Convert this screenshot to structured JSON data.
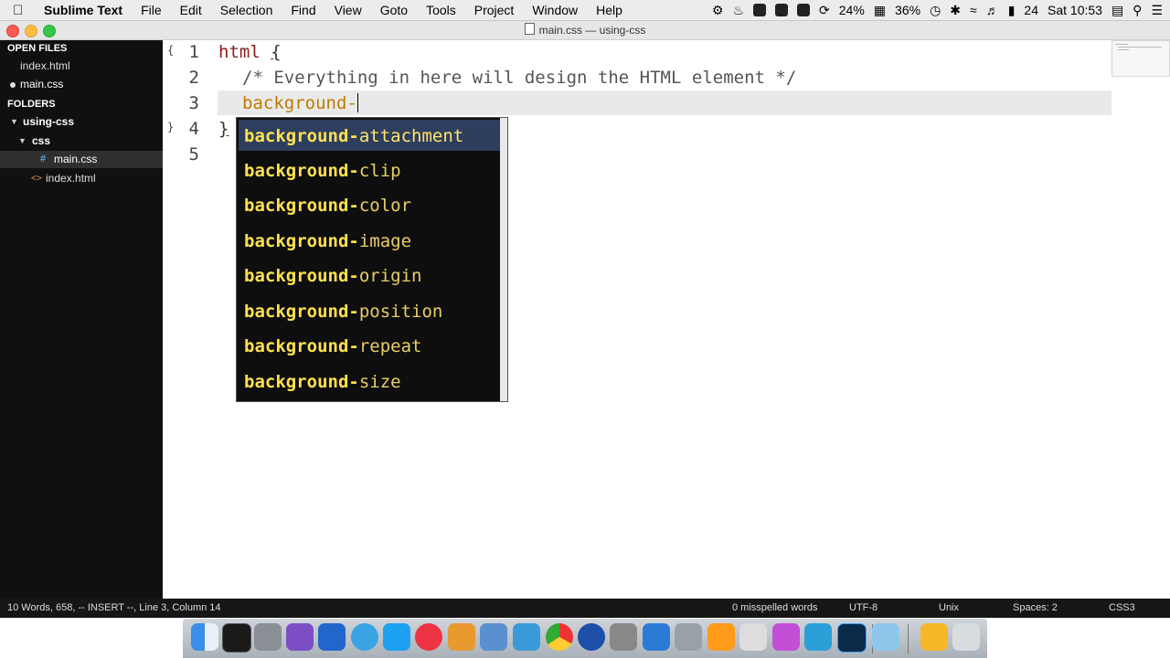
{
  "menubar": {
    "app_name": "Sublime Text",
    "items": [
      "File",
      "Edit",
      "Selection",
      "Find",
      "View",
      "Goto",
      "Tools",
      "Project",
      "Window",
      "Help"
    ],
    "battery1": "24%",
    "battery2": "36%",
    "date": "24",
    "clock": "Sat 10:53"
  },
  "window": {
    "title": "main.css — using-css"
  },
  "sidebar": {
    "open_files_header": "OPEN FILES",
    "open_files": [
      "index.html",
      "main.css"
    ],
    "folders_header": "FOLDERS",
    "folder_root": "using-css",
    "subfolder": "css",
    "css_file": "main.css",
    "root_file": "index.html"
  },
  "editor": {
    "line_numbers": [
      "1",
      "2",
      "3",
      "4",
      "5"
    ],
    "line1_selector": "html",
    "line1_brace": "{",
    "line2_comment": "/* Everything in here will design the HTML element */",
    "line3_typed": "background-",
    "line4_brace": "}"
  },
  "autocomplete": {
    "match": "background-",
    "items": [
      "attachment",
      "clip",
      "color",
      "image",
      "origin",
      "position",
      "repeat",
      "size"
    ]
  },
  "statusbar": {
    "left": "10 Words, 658, -- INSERT --, Line 3, Column 14",
    "spelling": "0 misspelled words",
    "encoding": "UTF-8",
    "line_endings": "Unix",
    "indent": "Spaces: 2",
    "syntax": "CSS3"
  },
  "colors": {
    "autocomplete_text": "#f1d34a",
    "autocomplete_selected_bg": "#2e3e5e",
    "property": "#c07a00",
    "selector": "#8b1c1c"
  }
}
